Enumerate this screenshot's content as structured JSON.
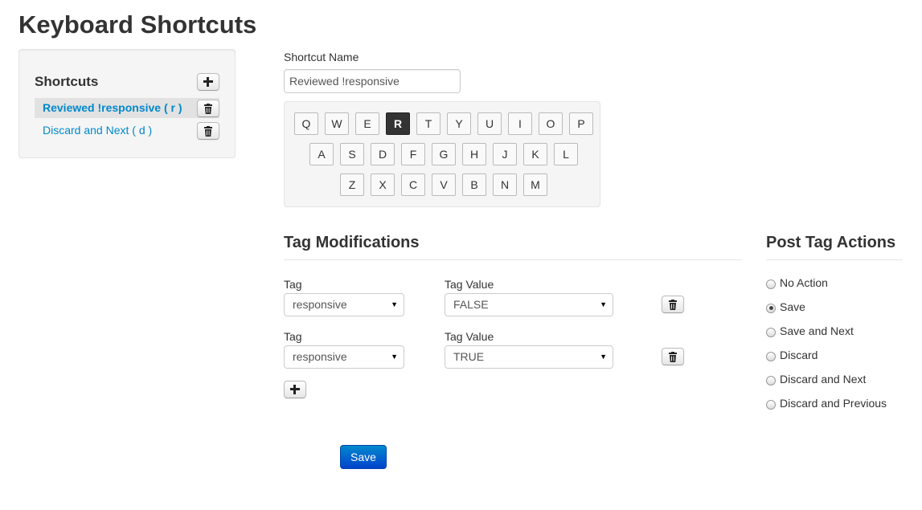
{
  "page": {
    "title": "Keyboard Shortcuts"
  },
  "sidebar": {
    "title": "Shortcuts",
    "add_icon": "plus-icon",
    "items": [
      {
        "label": "Reviewed !responsive ( r )",
        "active": true,
        "delete_icon": "trash-icon"
      },
      {
        "label": "Discard and Next ( d )",
        "active": false,
        "delete_icon": "trash-icon"
      }
    ]
  },
  "form": {
    "name_label": "Shortcut Name",
    "name_value": "Reviewed !responsive"
  },
  "keyboard": {
    "rows": [
      [
        "Q",
        "W",
        "E",
        "R",
        "T",
        "Y",
        "U",
        "I",
        "O",
        "P"
      ],
      [
        "A",
        "S",
        "D",
        "F",
        "G",
        "H",
        "J",
        "K",
        "L"
      ],
      [
        "Z",
        "X",
        "C",
        "V",
        "B",
        "N",
        "M"
      ]
    ],
    "selected": "R"
  },
  "tag_modifications": {
    "title": "Tag Modifications",
    "rows": [
      {
        "tag_label": "Tag",
        "tag_value": "responsive",
        "value_label": "Tag Value",
        "value": "FALSE"
      },
      {
        "tag_label": "Tag",
        "tag_value": "responsive",
        "value_label": "Tag Value",
        "value": "TRUE"
      }
    ],
    "add_icon": "plus-icon"
  },
  "post_tag_actions": {
    "title": "Post Tag Actions",
    "options": [
      "No Action",
      "Save",
      "Save and Next",
      "Discard",
      "Discard and Next",
      "Discard and Previous"
    ],
    "selected": "Save"
  },
  "save_label": "Save",
  "colors": {
    "primary": "#0088cc",
    "link": "#0088cc",
    "selected_key": "#333333"
  }
}
